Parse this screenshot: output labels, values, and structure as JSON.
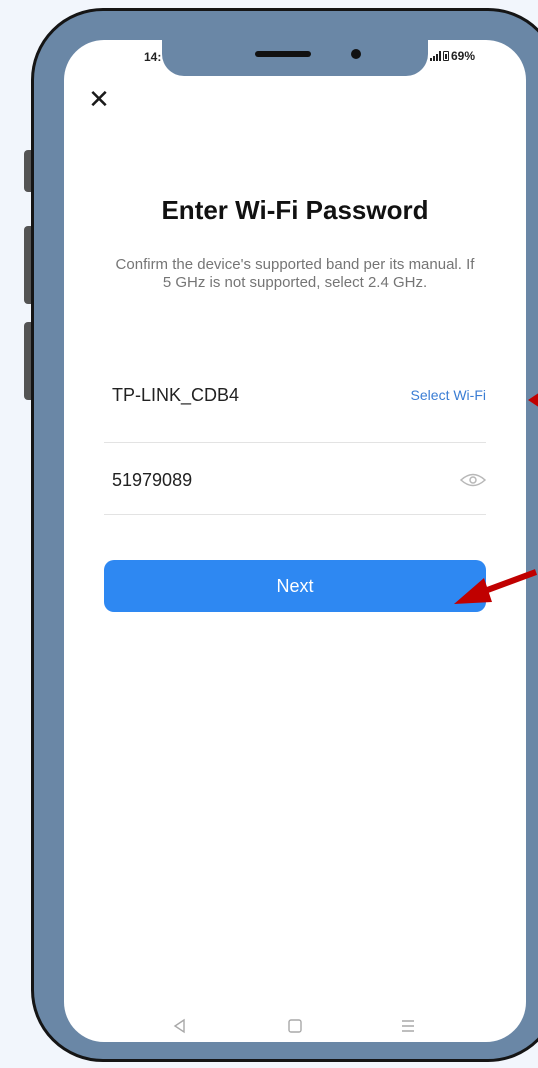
{
  "status_bar": {
    "time": "14:",
    "battery": "69%"
  },
  "dialog": {
    "close_icon": "close-icon",
    "title": "Enter Wi-Fi Password",
    "subtitle": "Confirm the device's supported band per its manual. If 5 GHz is not supported, select 2.4 GHz."
  },
  "form": {
    "ssid": "TP-LINK_CDB4",
    "select_wifi_label": "Select Wi-Fi",
    "password": "51979089",
    "password_toggle_icon": "eye-icon"
  },
  "next_button": {
    "label": "Next"
  },
  "nav_bar": [
    "back-icon",
    "home-icon",
    "menu-icon"
  ],
  "colors": {
    "accent": "#2e88f2",
    "link": "#3a7dd4",
    "phone_frame": "#6a87a6",
    "annotation_arrow": "#c00000"
  }
}
